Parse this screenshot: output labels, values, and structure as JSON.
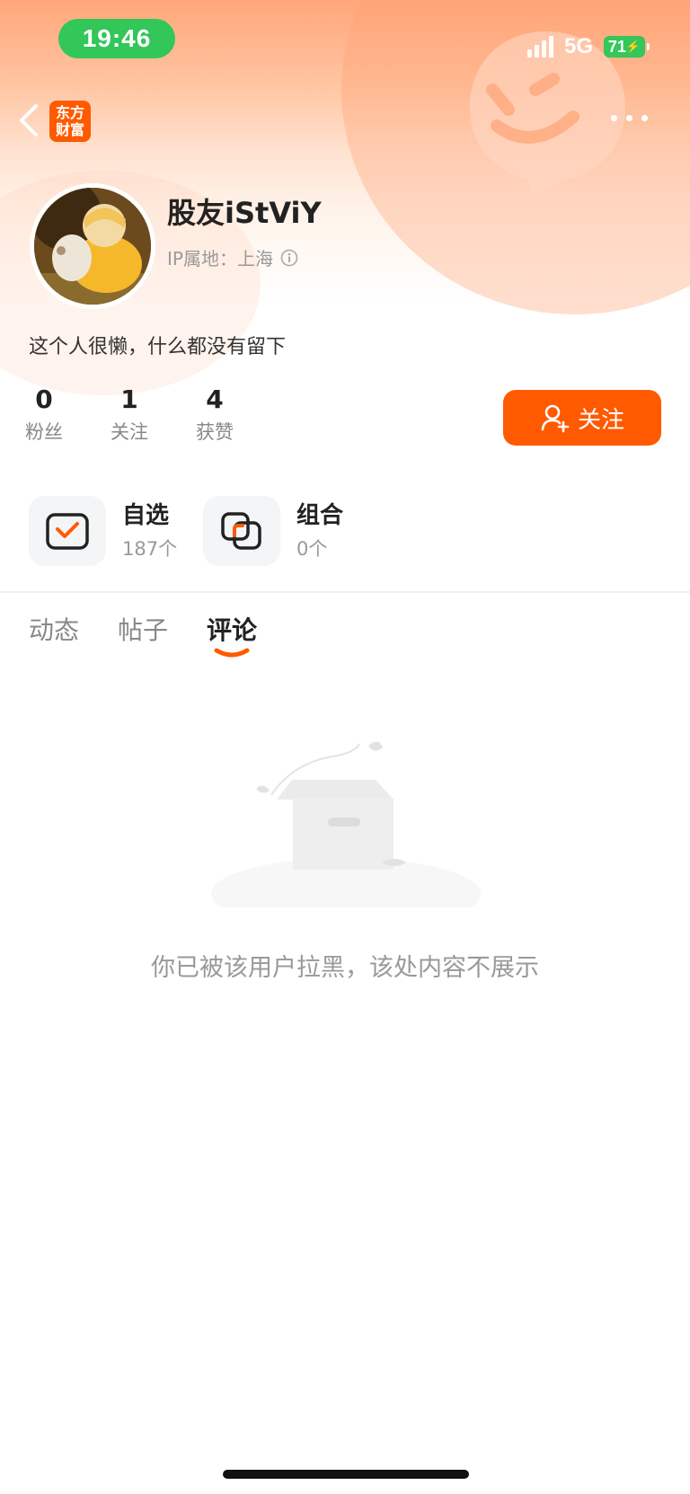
{
  "status_bar": {
    "time": "19:46",
    "network": "5G",
    "battery": "71"
  },
  "header": {
    "logo_line1": "东方",
    "logo_line2": "财富"
  },
  "profile": {
    "username": "股友iStViY",
    "ip_location": "IP属地：上海",
    "bio": "这个人很懒，什么都没有留下",
    "stats": [
      {
        "count": "0",
        "label": "粉丝"
      },
      {
        "count": "1",
        "label": "关注"
      },
      {
        "count": "4",
        "label": "获赞"
      }
    ],
    "follow_label": "关注"
  },
  "shortcuts": [
    {
      "title": "自选",
      "count": "187个"
    },
    {
      "title": "组合",
      "count": "0个"
    }
  ],
  "tabs": [
    {
      "label": "动态"
    },
    {
      "label": "帖子"
    },
    {
      "label": "评论"
    }
  ],
  "active_tab": "评论",
  "empty_state": {
    "message": "你已被该用户拉黑，该处内容不展示"
  },
  "colors": {
    "accent": "#ff5a00",
    "status_green": "#33c659"
  }
}
